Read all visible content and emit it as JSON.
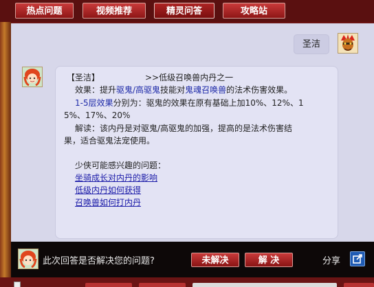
{
  "top_tabs": [
    {
      "label": "热点问题"
    },
    {
      "label": "视频推荐"
    },
    {
      "label": "精灵问答"
    },
    {
      "label": "攻略站"
    }
  ],
  "user_question": {
    "text": "圣洁"
  },
  "answer": {
    "heading": "【圣洁】",
    "path": ">>低级召唤兽内丹之一",
    "effect_prefix": "效果：提升",
    "effect_kw1": "驱鬼/高驱鬼",
    "effect_mid": "技能对",
    "effect_kw2": "鬼魂召唤兽",
    "effect_suffix": "的法术伤害效果。",
    "levels_kw": "1-5层效果",
    "levels_rest": "分别为：驱鬼的效果在原有基础上加10%、12%、15%、17%、20%",
    "levels_line1_rest": "分别为：驱鬼的效果在原有基础上加10%、12%、1",
    "levels_line2": "5%、17%、20%",
    "explain_line1": "解读：该内丹是对驱鬼/高驱鬼的加强，提高的是法术伤害结",
    "explain_line2": "果，适合驱鬼法宠使用。",
    "related_title": "少侠可能感兴趣的问题：",
    "related_links": [
      "坐骑成长对内丹的影响",
      "低级内丹如何获得",
      "召唤兽如何打内丹"
    ]
  },
  "feedback": {
    "question": "此次回答是否解决您的问题?",
    "unsolved_label": "未解决",
    "solved_label": "解 决",
    "share_label": "分享"
  },
  "colors": {
    "tab_red": "#a82424",
    "panel_bg": "#d7d7ea",
    "bubble_bg": "#e3e3f4",
    "keyword_blue": "#1e2aa8",
    "feedback_bg": "#0d0808"
  }
}
